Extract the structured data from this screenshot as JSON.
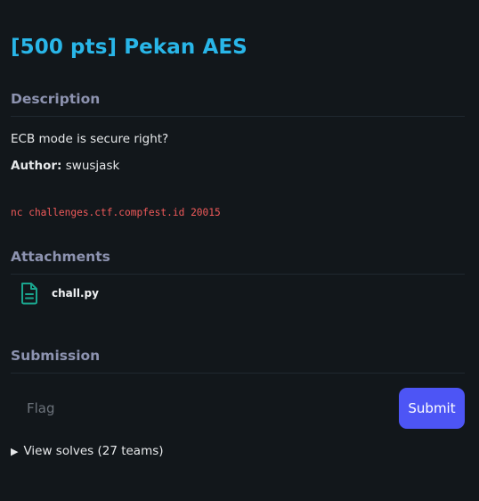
{
  "challenge": {
    "title": "[500 pts] Pekan AES"
  },
  "description": {
    "heading": "Description",
    "text": "ECB mode is secure right?",
    "author_label": "Author:",
    "author_name": "swusjask",
    "connection": "nc challenges.ctf.compfest.id 20015"
  },
  "attachments": {
    "heading": "Attachments",
    "files": [
      {
        "name": "chall.py",
        "icon": "file-icon"
      }
    ]
  },
  "submission": {
    "heading": "Submission",
    "flag_placeholder": "Flag",
    "flag_value": "",
    "submit_label": "Submit"
  },
  "solves": {
    "toggle_icon": "triangle-right-icon",
    "label": "View solves (27 teams)"
  },
  "colors": {
    "background": "#12171b",
    "title": "#29b6e8",
    "heading": "#8d93b0",
    "code": "#f05a5a",
    "icon": "#1aa58e",
    "button": "#4d55f5"
  }
}
